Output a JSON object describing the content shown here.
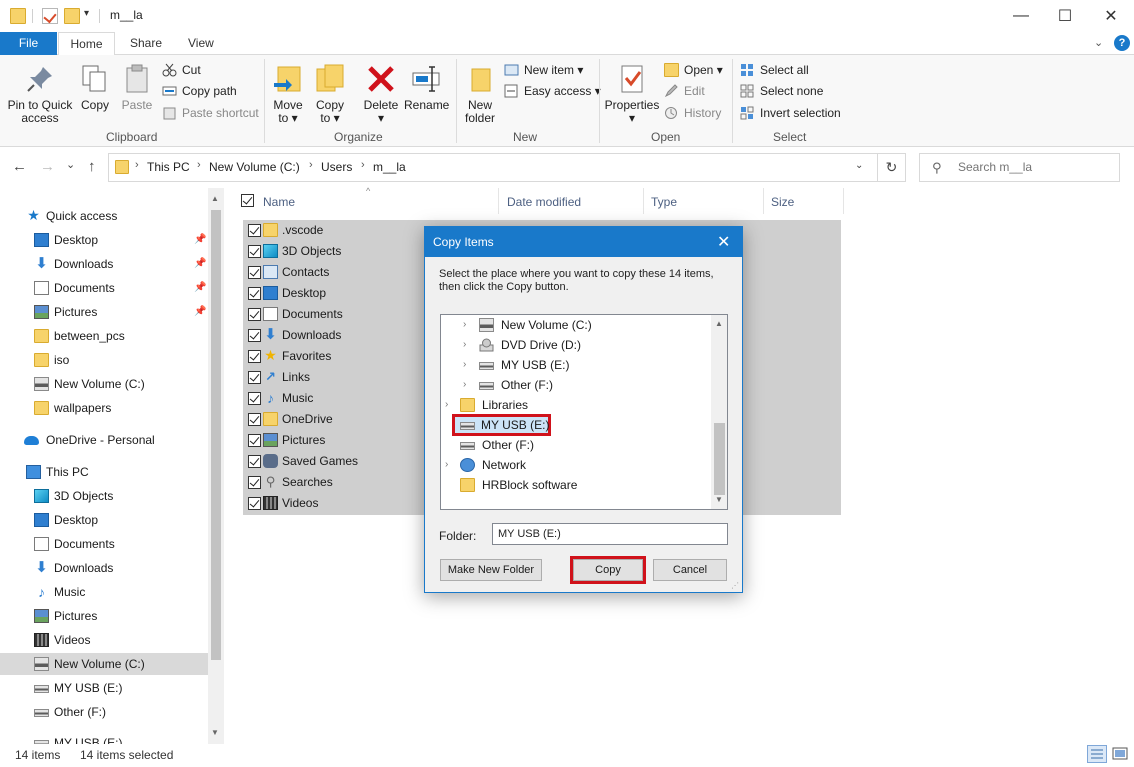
{
  "window": {
    "title": "m__la",
    "qa_dropdown": "▾",
    "min_glyph": "—",
    "max_glyph": "☐",
    "close_glyph": "✕"
  },
  "ribbon_tabs": [
    "File",
    "Home",
    "Share",
    "View"
  ],
  "ribbon": {
    "help_glyph": "?",
    "help_chevron": "⌄",
    "clipboard": {
      "pin_label": "Pin to Quick access",
      "copy_label": "Copy",
      "paste_label": "Paste",
      "cut_label": "Cut",
      "copy_path_label": "Copy path",
      "paste_shortcut_label": "Paste shortcut",
      "group_label": "Clipboard"
    },
    "organize": {
      "move_to_label": "Move to ▾",
      "copy_to_label": "Copy to ▾",
      "delete_label": "Delete ▾",
      "rename_label": "Rename",
      "group_label": "Organize"
    },
    "new": {
      "new_folder_label": "New folder",
      "new_item_label": "New item ▾",
      "easy_access_label": "Easy access ▾",
      "group_label": "New"
    },
    "open": {
      "properties_label": "Properties ▾",
      "open_label": "Open ▾",
      "edit_label": "Edit",
      "history_label": "History",
      "group_label": "Open"
    },
    "select": {
      "select_all_label": "Select all",
      "select_none_label": "Select none",
      "invert_label": "Invert selection",
      "group_label": "Select"
    }
  },
  "nav": {
    "back": "←",
    "forward": "→",
    "recent": "⌄",
    "up": "↑",
    "refresh": "↻",
    "addr_dropdown": "⌄",
    "breadcrumbs": [
      "This PC",
      "New Volume (C:)",
      "Users",
      "m__la"
    ],
    "crumb_sep": "›",
    "search_placeholder": "Search m__la",
    "search_glyph": "⚲"
  },
  "navpane": {
    "items": [
      {
        "label": "Quick access",
        "icon": "star-icon",
        "pinned": false
      },
      {
        "label": "Desktop",
        "icon": "desktop-icon",
        "pinned": true
      },
      {
        "label": "Downloads",
        "icon": "downloads-icon",
        "pinned": true
      },
      {
        "label": "Documents",
        "icon": "documents-icon",
        "pinned": true
      },
      {
        "label": "Pictures",
        "icon": "pictures-icon",
        "pinned": true
      },
      {
        "label": "between_pcs",
        "icon": "folder-icon",
        "pinned": false
      },
      {
        "label": "iso",
        "icon": "folder-icon",
        "pinned": false
      },
      {
        "label": "New Volume (C:)",
        "icon": "drive-icon",
        "pinned": false
      },
      {
        "label": "wallpapers",
        "icon": "folder-icon",
        "pinned": false
      },
      {
        "label": "OneDrive - Personal",
        "icon": "onedrive-icon",
        "pinned": false
      },
      {
        "label": "This PC",
        "icon": "this-pc-icon",
        "pinned": false
      },
      {
        "label": "3D Objects",
        "icon": "3d-objects-icon",
        "pinned": false
      },
      {
        "label": "Desktop",
        "icon": "desktop-icon",
        "pinned": false
      },
      {
        "label": "Documents",
        "icon": "documents-icon",
        "pinned": false
      },
      {
        "label": "Downloads",
        "icon": "downloads-icon",
        "pinned": false
      },
      {
        "label": "Music",
        "icon": "music-icon",
        "pinned": false
      },
      {
        "label": "Pictures",
        "icon": "pictures-icon",
        "pinned": false
      },
      {
        "label": "Videos",
        "icon": "videos-icon",
        "pinned": false
      },
      {
        "label": "New Volume (C:)",
        "icon": "drive-icon",
        "pinned": false
      },
      {
        "label": "MY USB (E:)",
        "icon": "usb-drive-icon",
        "pinned": false
      },
      {
        "label": "Other (F:)",
        "icon": "drive-icon",
        "pinned": false
      },
      {
        "label": "MY USB (E:)",
        "icon": "usb-drive-icon",
        "pinned": false
      }
    ],
    "pin_glyph": "📌",
    "selected_label": "New Volume (C:)"
  },
  "filelist": {
    "columns": [
      "Name",
      "Date modified",
      "Type",
      "Size"
    ],
    "sort_glyph": "^",
    "rows": [
      {
        "name": ".vscode",
        "icon": "folder-icon"
      },
      {
        "name": "3D Objects",
        "icon": "3d-objects-icon"
      },
      {
        "name": "Contacts",
        "icon": "contacts-icon"
      },
      {
        "name": "Desktop",
        "icon": "desktop-icon"
      },
      {
        "name": "Documents",
        "icon": "documents-icon"
      },
      {
        "name": "Downloads",
        "icon": "downloads-icon"
      },
      {
        "name": "Favorites",
        "icon": "favorites-icon"
      },
      {
        "name": "Links",
        "icon": "links-icon"
      },
      {
        "name": "Music",
        "icon": "music-icon"
      },
      {
        "name": "OneDrive",
        "icon": "folder-icon"
      },
      {
        "name": "Pictures",
        "icon": "pictures-icon"
      },
      {
        "name": "Saved Games",
        "icon": "saved-games-icon"
      },
      {
        "name": "Searches",
        "icon": "searches-icon"
      },
      {
        "name": "Videos",
        "icon": "videos-icon"
      }
    ]
  },
  "status": {
    "item_count": "14 items",
    "selected_count": "14 items selected"
  },
  "dialog": {
    "title": "Copy Items",
    "close_glyph": "✕",
    "message": "Select the place where you want to copy these 14 items, then click the Copy button.",
    "tree": [
      {
        "label": "New Volume (C:)",
        "icon": "drive-icon",
        "indent": 1,
        "chevron": "›",
        "highlighted": false
      },
      {
        "label": "DVD Drive (D:)",
        "icon": "dvd-drive-icon",
        "indent": 1,
        "chevron": "›",
        "highlighted": false
      },
      {
        "label": "MY USB (E:)",
        "icon": "usb-drive-icon",
        "indent": 1,
        "chevron": "›",
        "highlighted": false
      },
      {
        "label": "Other (F:)",
        "icon": "drive-icon",
        "indent": 1,
        "chevron": "›",
        "highlighted": false
      },
      {
        "label": "Libraries",
        "icon": "libraries-icon",
        "indent": 0,
        "chevron": "›",
        "highlighted": false
      },
      {
        "label": "MY USB (E:)",
        "icon": "usb-drive-icon",
        "indent": 0,
        "chevron": "",
        "highlighted": true
      },
      {
        "label": "Other (F:)",
        "icon": "drive-icon",
        "indent": 0,
        "chevron": "",
        "highlighted": false
      },
      {
        "label": "Network",
        "icon": "network-icon",
        "indent": 0,
        "chevron": "›",
        "highlighted": false
      },
      {
        "label": "HRBlock software",
        "icon": "folder-icon",
        "indent": 0,
        "chevron": "",
        "highlighted": false
      }
    ],
    "scroll_up": "▲",
    "scroll_down": "▼",
    "folder_label": "Folder:",
    "folder_value": "MY USB (E:)",
    "make_new_folder_label": "Make New Folder",
    "copy_label": "Copy",
    "cancel_label": "Cancel",
    "grip": "⋰"
  },
  "colors": {
    "accent": "#1979ca",
    "highlight_red": "#d0121b",
    "selection_gray": "#cfcfcf"
  }
}
